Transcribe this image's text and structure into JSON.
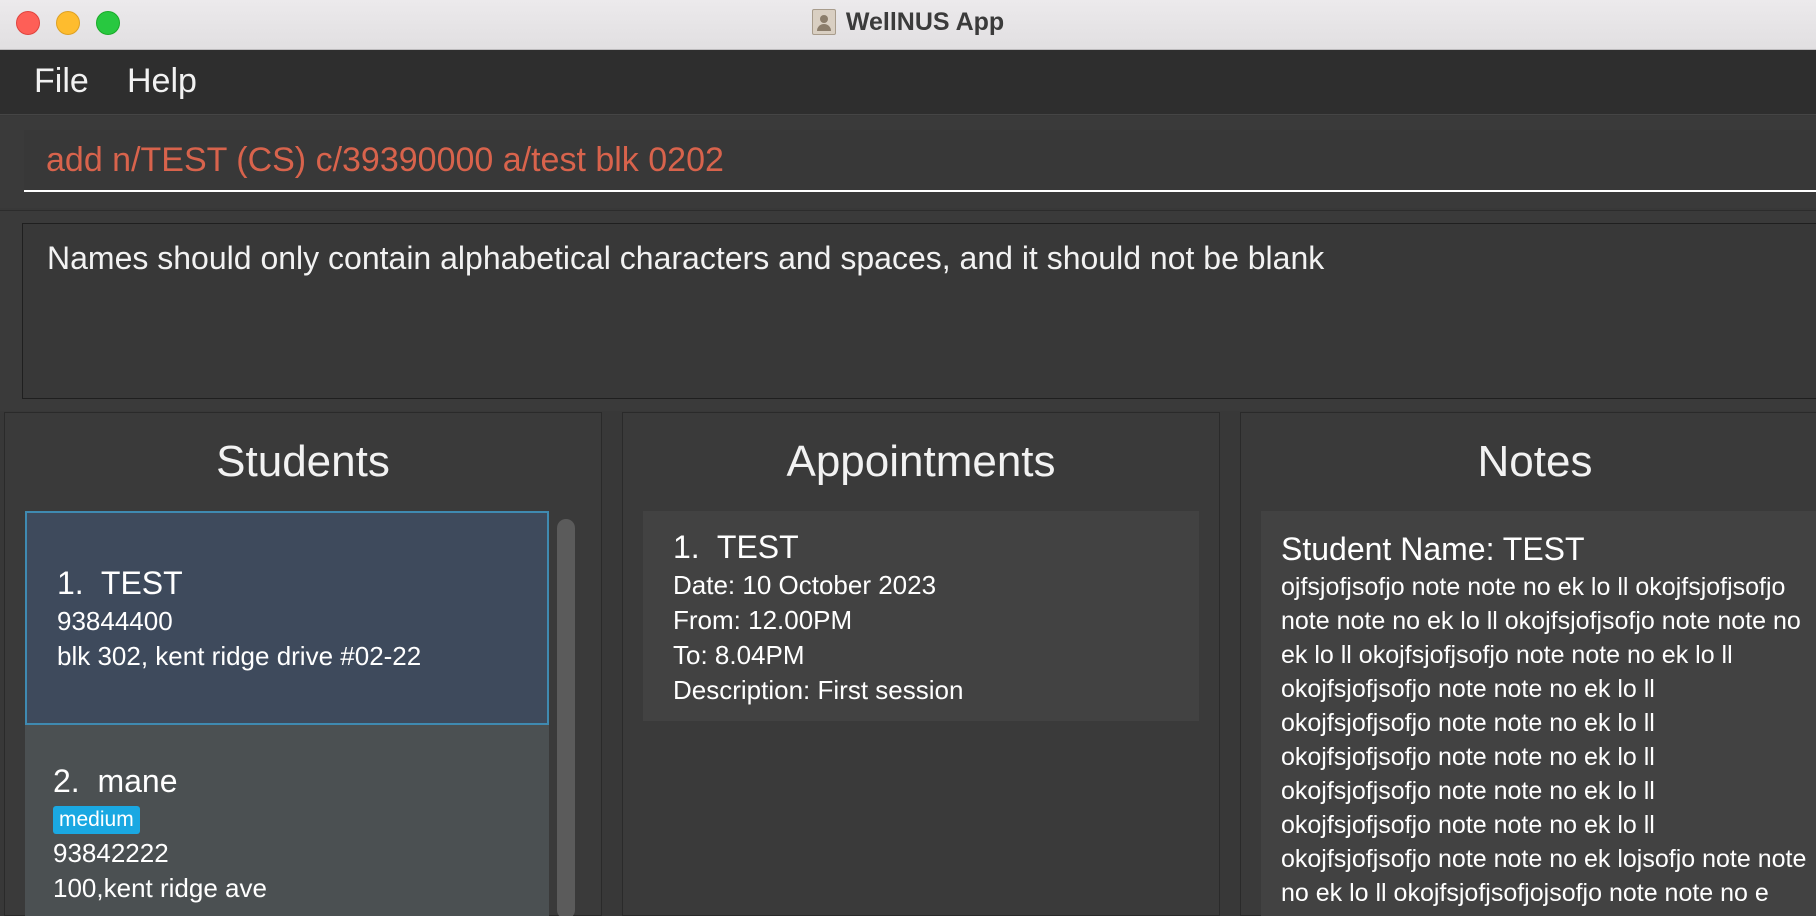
{
  "window": {
    "title": "WellNUS App"
  },
  "menu": {
    "file": "File",
    "help": "Help"
  },
  "command": {
    "value": "add n/TEST (CS) c/39390000 a/test blk 0202"
  },
  "result": {
    "message": "Names should only contain alphabetical characters and spaces, and it should not be blank"
  },
  "students": {
    "title": "Students",
    "items": [
      {
        "index": "1.",
        "name": "TEST",
        "phone": "93844400",
        "address": "blk 302, kent ridge drive #02-22"
      },
      {
        "index": "2.",
        "name": "mane",
        "tag": "medium",
        "phone": "93842222",
        "address": "100,kent ridge ave"
      }
    ]
  },
  "appointments": {
    "title": "Appointments",
    "items": [
      {
        "index": "1.",
        "name": "TEST",
        "date": "Date: 10 October 2023",
        "from": "From: 12.00PM",
        "to": "To: 8.04PM",
        "description": "Description: First session"
      }
    ]
  },
  "notes": {
    "title": "Notes",
    "items": [
      {
        "student": "Student Name: TEST",
        "content": "ojfsjofjsofjo note note no ek lo ll okojfsjofjsofjo note note no ek lo ll okojfsjofjsofjo note note no ek lo ll okojfsjofjsofjo note note no ek lo ll okojfsjofjsofjo note note no ek lo ll okojfsjofjsofjo note note no ek lo ll okojfsjofjsofjo note note no ek lo ll okojfsjofjsofjo note note no ek lo ll okojfsjofjsofjo note note no ek lo ll okojfsjofjsofjo note note no ek lojsofjo note note no ek lo ll okojfsjofjsofjojsofjo note note no e"
      }
    ]
  },
  "colors": {
    "accent": "#3f8ab1",
    "tag": "#1aa8e2",
    "command_text": "#d8634c"
  }
}
